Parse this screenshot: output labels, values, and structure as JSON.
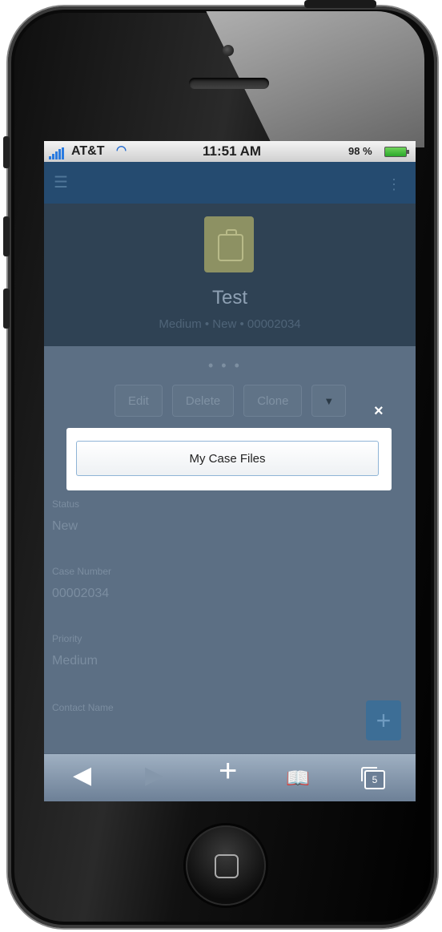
{
  "status": {
    "carrier": "AT&T",
    "time": "11:51 AM",
    "battery": "98 %"
  },
  "record": {
    "title": "Test",
    "subtitle": "Medium • New • 00002034"
  },
  "actions": {
    "edit": "Edit",
    "delete": "Delete",
    "clone": "Clone",
    "more": "▼"
  },
  "fields": [
    {
      "label": "Status",
      "value": "New"
    },
    {
      "label": "Case Number",
      "value": "00002034"
    },
    {
      "label": "Priority",
      "value": "Medium"
    },
    {
      "label": "Contact Name",
      "value": ""
    }
  ],
  "modal": {
    "close": "×",
    "button": "My Case Files"
  },
  "fab": "+",
  "toolbar": {
    "back": "◀",
    "forward": "▶",
    "add": "+",
    "bookmarks": "📖",
    "tabs_count": "5"
  },
  "colors": {
    "appbar": "#254b70",
    "hero": "#2f4254",
    "overlay": "#5c6f84",
    "accent": "#2a7be0"
  }
}
